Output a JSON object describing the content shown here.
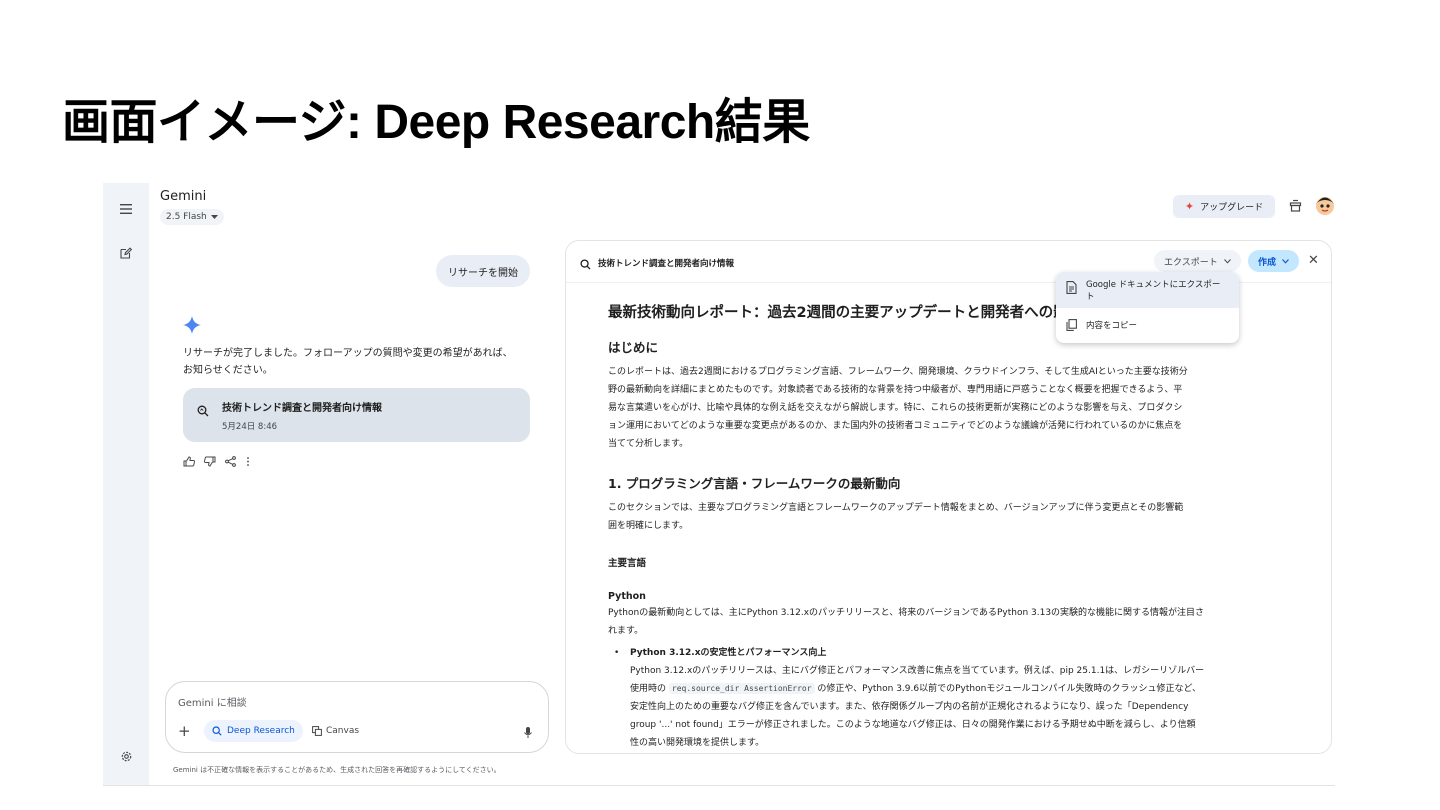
{
  "slide": {
    "title": "画面イメージ: Deep Research結果"
  },
  "header": {
    "app_name": "Gemini",
    "model": "2.5 Flash",
    "upgrade_label": "アップグレード"
  },
  "chat": {
    "user_message": "リサーチを開始",
    "reply_line1": "リサーチが完了しました。フォローアップの質問や変更の希望があれば、",
    "reply_line2": "お知らせください。",
    "card_title": "技術トレンド調査と開発者向け情報",
    "card_date": "5月24日 8:46",
    "input_placeholder": "Gemini に相談",
    "deep_research_label": "Deep Research",
    "canvas_label": "Canvas",
    "disclaimer": "Gemini は不正確な情報を表示することがあるため、生成された回答を再確認するようにしてください。"
  },
  "panel": {
    "title": "技術トレンド調査と開発者向け情報",
    "export_label": "エクスポート",
    "create_label": "作成",
    "menu": {
      "export_docs_line1": "Google ドキュメントにエクスポー",
      "export_docs_line2": "ト",
      "copy": "内容をコピー"
    },
    "doc": {
      "title": "最新技術動向レポート：過去2週間の主要アップデートと開発者への影",
      "intro_heading": "はじめに",
      "intro_p1": "このレポートは、過去2週間におけるプログラミング言語、フレームワーク、開発環境、クラウドインフラ、そして生成AIといった主要な技術分",
      "intro_p2": "野の最新動向を詳細にまとめたものです。対象読者である技術的な背景を持つ中級者が、専門用語に戸惑うことなく概要を把握できるよう、平",
      "intro_p3": "易な言葉遣いを心がけ、比喩や具体的な例え話を交えながら解説します。特に、これらの技術更新が実務にどのような影響を与え、プロダクシ",
      "intro_p4": "ョン運用においてどのような重要な変更点があるのか、また国内外の技術者コミュニティでどのような議論が活発に行われているのかに焦点を",
      "intro_p5": "当てて分析します。",
      "sec1_heading": "1. プログラミング言語・フレームワークの最新動向",
      "sec1_p1": "このセクションでは、主要なプログラミング言語とフレームワークのアップデート情報をまとめ、バージョンアップに伴う変更点とその影響範",
      "sec1_p2": "囲を明確にします。",
      "lang_heading": "主要言語",
      "python_heading": "Python",
      "python_p1": "Pythonの最新動向としては、主にPython 3.12.xのパッチリリースと、将来のバージョンであるPython 3.13の実験的な機能に関する情報が注目さ",
      "python_p2": "れます。",
      "bullet_title": "Python 3.12.xの安定性とパフォーマンス向上",
      "bullet_l1": "Python 3.12.xのパッチリリースは、主にバグ修正とパフォーマンス改善に焦点を当てています。例えば、pip 25.1.1は、レガシーリゾルバー",
      "bullet_l2_pre": "使用時の ",
      "bullet_code": "req.source_dir AssertionError",
      "bullet_l2_post": " の修正や、Python 3.9.6以前でのPythonモジュールコンパイル失敗時のクラッシュ修正など、",
      "bullet_l3": "安定性向上のための重要なバグ修正を含んでいます。また、依存関係グループ内の名前が正規化されるようになり、誤った「Dependency",
      "bullet_l4": "group '...' not found」エラーが修正されました。このような地道なバグ修正は、日々の開発作業における予期せぬ中断を減らし、より信頼",
      "bullet_l5": "性の高い開発環境を提供します。"
    }
  },
  "colors": {
    "rail_bg": "#f0f4f9",
    "accent_blue": "#0b57d0",
    "create_bg": "#c2e7ff",
    "card_bg": "#dde3ea",
    "spark_blue": "#4a86f5"
  }
}
